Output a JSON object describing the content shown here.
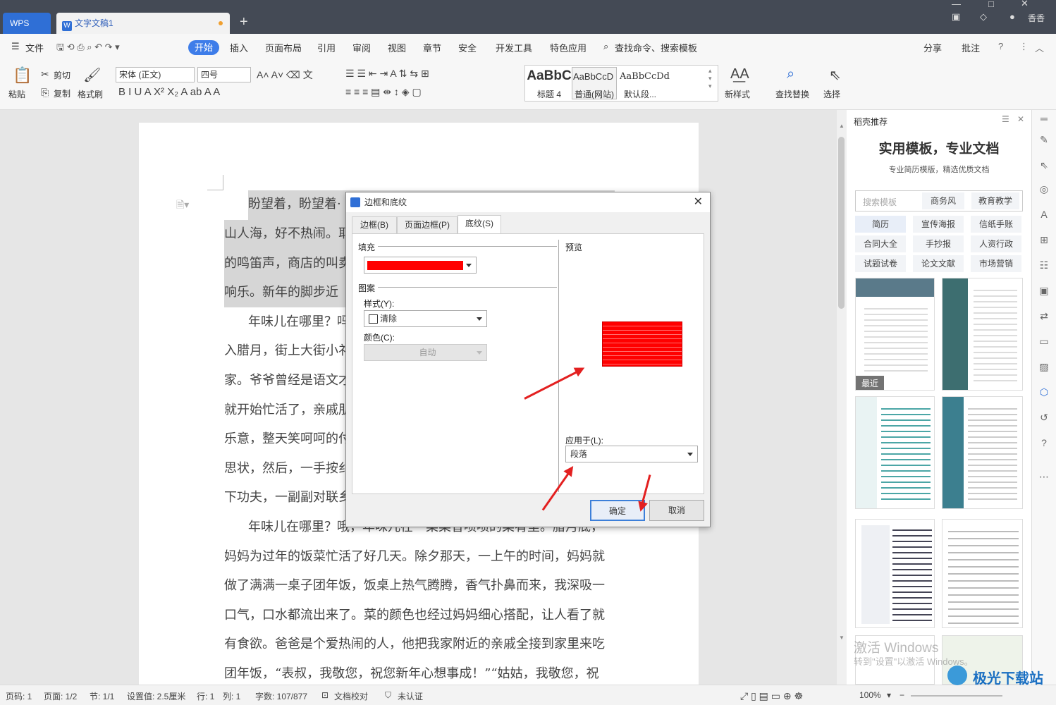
{
  "titlebar": {
    "app_tab": "WPS",
    "doc_tab": "文字文稿1",
    "user": "香香"
  },
  "menubar": {
    "file": "文件",
    "tabs": [
      "开始",
      "插入",
      "页面布局",
      "引用",
      "审阅",
      "视图",
      "章节",
      "安全",
      "开发工具",
      "特色应用"
    ],
    "search": "查找命令、搜索模板",
    "share": "分享",
    "comment": "批注"
  },
  "ribbon": {
    "paste": "粘贴",
    "cut": "剪切",
    "copy": "复制",
    "format_painter": "格式刷",
    "font_name": "宋体 (正文)",
    "font_size": "四号",
    "styles": [
      {
        "preview": "AaBbC",
        "name": "标题 4"
      },
      {
        "preview": "AaBbCcD",
        "name": "普通(网站)"
      },
      {
        "preview": "AaBbCcDd",
        "name": "默认段..."
      }
    ],
    "new_style": "新样式",
    "find_replace": "查找替换",
    "select": "选择"
  },
  "document": {
    "paragraphs": [
      "盼望着，盼望着·",
      "山人海，好不热闹。耶",
      "的鸣笛声，商店的叫卖",
      "响乐。新年的脚步近",
      "年味儿在哪里？吗",
      "入腊月，街上大街小礻",
      "家。爷爷曾经是语文才",
      "就开始忙活了，亲戚朋",
      "乐意，整天笑呵呵的付",
      "思状，然后，一手按纟",
      "下功夫，一副副对联乡",
      "年味儿在哪里？哦，年味儿在一菜菜香喷喷的菜肴里。腊月底，",
      "妈妈为过年的饭菜忙活了好几天。除夕那天，一上午的时间，妈妈就",
      "做了满满一桌子团年饭，饭桌上热气腾腾，香气扑鼻而来，我深吸一",
      "口气，口水都流出来了。菜的颜色也经过妈妈细心搭配，让人看了就",
      "有食欲。爸爸是个爱热闹的人，他把我家附近的亲戚全接到家里来吃",
      "团年饭，“表叔，我敬您，祝您新年心想事成！”“姑姑，我敬您，祝"
    ]
  },
  "dialog": {
    "title": "边框和底纹",
    "tabs": [
      "边框(B)",
      "页面边框(P)",
      "底纹(S)"
    ],
    "active_tab": "底纹(S)",
    "fill_label": "填充",
    "fill_color": "#ff0000",
    "pattern_label": "图案",
    "style_label": "样式(Y):",
    "style_value": "清除",
    "color_label": "颜色(C):",
    "color_value": "自动",
    "preview_label": "预览",
    "apply_label": "应用于(L):",
    "apply_value": "段落",
    "ok": "确定",
    "cancel": "取消"
  },
  "panel": {
    "header": "稻壳推荐",
    "title": "实用模板，专业文档",
    "subtitle": "专业简历模版，精选优质文档",
    "search_placeholder": "搜索模板",
    "search_tags": [
      "商务风",
      "教育教学"
    ],
    "tags": [
      "简历",
      "宣传海报",
      "信纸手账",
      "合同大全",
      "手抄报",
      "人资行政",
      "试题试卷",
      "论文文献",
      "市场营销"
    ],
    "recent_badge": "最近",
    "watermark1": "激活 Windows",
    "watermark2": "转到\"设置\"以激活 Windows。"
  },
  "statusbar": {
    "page": "页码: 1",
    "pages": "页面: 1/2",
    "section": "节: 1/1",
    "setting": "设置值: 2.5厘米",
    "row": "行: 1",
    "col": "列: 1",
    "words": "字数: 107/877",
    "proof": "文档校对",
    "cert": "未认证",
    "zoom": "100%"
  },
  "logo": "极光下载站"
}
